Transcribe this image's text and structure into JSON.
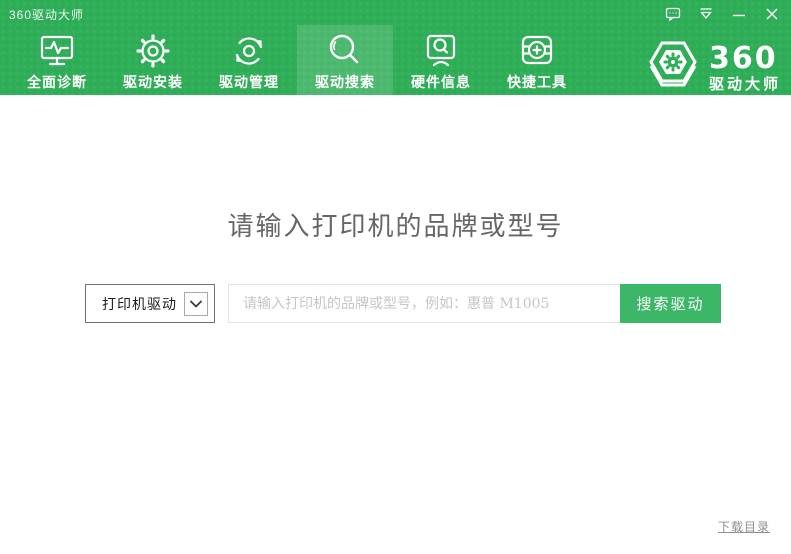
{
  "window": {
    "title": "360驱动大师",
    "controls": [
      {
        "name": "feedback",
        "icon": "feedback-bubble-icon"
      },
      {
        "name": "menu",
        "icon": "skin-menu-icon"
      },
      {
        "name": "minimize",
        "icon": "minimize-icon"
      },
      {
        "name": "close",
        "icon": "close-icon"
      }
    ]
  },
  "header": {
    "tabs": [
      {
        "label": "全面诊断",
        "icon": "diagnose-monitor-icon",
        "active": false
      },
      {
        "label": "驱动安装",
        "icon": "gear-icon",
        "active": false
      },
      {
        "label": "驱动管理",
        "icon": "sync-refresh-icon",
        "active": false
      },
      {
        "label": "驱动搜索",
        "icon": "search-icon",
        "active": true
      },
      {
        "label": "硬件信息",
        "icon": "hardware-info-icon",
        "active": false
      },
      {
        "label": "快捷工具",
        "icon": "toolbox-icon",
        "active": false
      }
    ],
    "logo": {
      "brand": "360",
      "product": "驱动大师",
      "icon": "hexagon-gear-logo-icon"
    }
  },
  "main": {
    "heading": "请输入打印机的品牌或型号",
    "search": {
      "category_value": "打印机驱动",
      "input_value": "",
      "input_placeholder": "请输入打印机的品牌或型号，例如：惠普 M1005",
      "button_label": "搜索驱动"
    },
    "footer_link": "下载目录"
  },
  "colors": {
    "header_green": "#2fae58",
    "active_tab_overlay": "#4cbb72",
    "button_green": "#3bb767",
    "heading_gray": "#666666",
    "placeholder_gray": "#c6c6c6"
  }
}
